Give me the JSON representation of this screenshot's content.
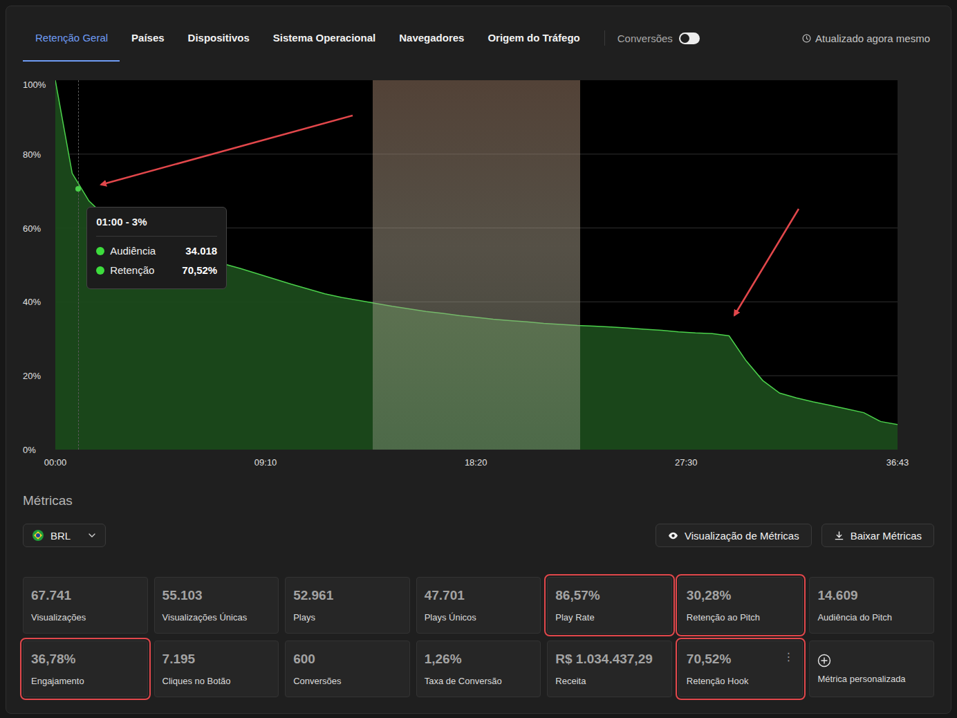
{
  "tabs": [
    {
      "label": "Retenção Geral",
      "selected": true
    },
    {
      "label": "Países",
      "selected": false
    },
    {
      "label": "Dispositivos",
      "selected": false
    },
    {
      "label": "Sistema Operacional",
      "selected": false
    },
    {
      "label": "Navegadores",
      "selected": false
    },
    {
      "label": "Origem do Tráfego",
      "selected": false
    }
  ],
  "conversions_toggle": {
    "label": "Conversões",
    "on": false
  },
  "updated": "Atualizado agora mesmo",
  "chart": {
    "y_ticks": [
      "100%",
      "80%",
      "60%",
      "40%",
      "20%",
      "0%"
    ],
    "x_ticks": [
      "00:00",
      "09:10",
      "18:20",
      "27:30",
      "36:43"
    ],
    "series": [
      {
        "name": "Retenção",
        "values": [
          100,
          74.8,
          67.3,
          63.0,
          59.3,
          56.9,
          55.4,
          54.0,
          52.8,
          51.5,
          50.3,
          49.0,
          47.6,
          46.2,
          44.8,
          43.5,
          42.2,
          41.2,
          40.4,
          39.6,
          38.8,
          38.1,
          37.4,
          36.9,
          36.3,
          35.8,
          35.3,
          34.9,
          34.6,
          34.2,
          33.9,
          33.6,
          33.4,
          33.2,
          32.9,
          32.6,
          32.3,
          31.9,
          31.6,
          31.4,
          30.8,
          24.1,
          18.7,
          15.3,
          14.0,
          12.9,
          12.0,
          11.0,
          10.0,
          7.6,
          6.8
        ]
      }
    ],
    "tooltip": {
      "title": "01:00 - 3%",
      "rows": [
        {
          "label": "Audiência",
          "value": "34.018"
        },
        {
          "label": "Retenção",
          "value": "70,52%"
        }
      ]
    }
  },
  "metrics": {
    "title": "Métricas",
    "currency": "BRL",
    "buttons": [
      {
        "label": "Visualização de Métricas",
        "kind": "view"
      },
      {
        "label": "Baixar Métricas",
        "kind": "download"
      }
    ],
    "cards": [
      {
        "kind": "metric",
        "value": "67.741",
        "label": "Visualizações",
        "highlighted": false
      },
      {
        "kind": "metric",
        "value": "55.103",
        "label": "Visualizações Únicas",
        "highlighted": false
      },
      {
        "kind": "metric",
        "value": "52.961",
        "label": "Plays",
        "highlighted": false
      },
      {
        "kind": "metric",
        "value": "47.701",
        "label": "Plays Únicos",
        "highlighted": false
      },
      {
        "kind": "metric",
        "value": "86,57%",
        "label": "Play Rate",
        "highlighted": true
      },
      {
        "kind": "metric",
        "value": "30,28%",
        "label": "Retenção ao Pitch",
        "highlighted": true
      },
      {
        "kind": "metric",
        "value": "14.609",
        "label": "Audiência do Pitch",
        "highlighted": false
      },
      {
        "kind": "metric",
        "value": "36,78%",
        "label": "Engajamento",
        "highlighted": true
      },
      {
        "kind": "metric",
        "value": "7.195",
        "label": "Cliques no Botão",
        "highlighted": false
      },
      {
        "kind": "metric",
        "value": "600",
        "label": "Conversões",
        "highlighted": false
      },
      {
        "kind": "metric",
        "value": "1,26%",
        "label": "Taxa de Conversão",
        "highlighted": false
      },
      {
        "kind": "metric",
        "value": "R$ 1.034.437,29",
        "label": "Receita",
        "highlighted": false
      },
      {
        "kind": "metric",
        "value": "70,52%",
        "label": "Retenção Hook",
        "highlighted": true,
        "menu": "⋮"
      },
      {
        "kind": "add",
        "label": "Métrica personalizada",
        "highlighted": false
      }
    ]
  }
}
